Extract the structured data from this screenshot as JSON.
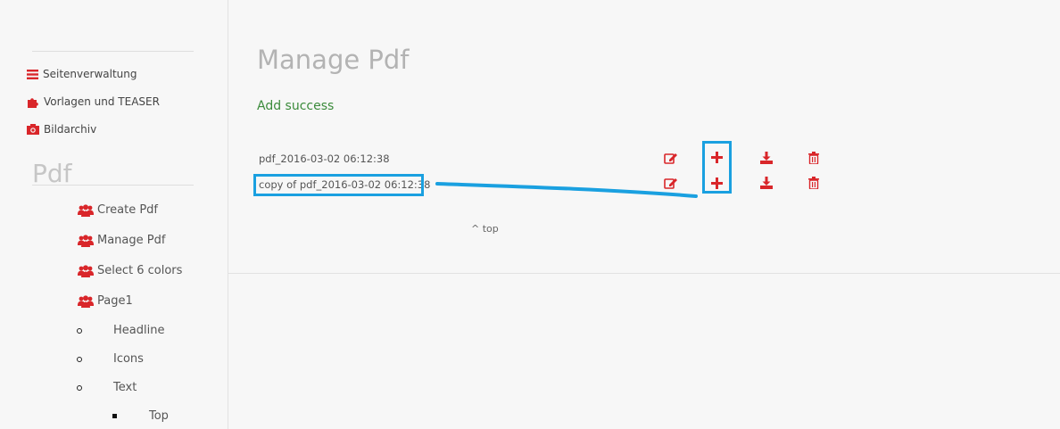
{
  "sidebar": {
    "nav": [
      {
        "label": "Seitenverwaltung",
        "icon": "bars-icon"
      },
      {
        "label": "Vorlagen und TEASER",
        "icon": "puzzle-icon"
      },
      {
        "label": "Bildarchiv",
        "icon": "camera-icon"
      }
    ],
    "section_title": "Pdf",
    "sub_items": [
      {
        "label": "Create Pdf",
        "icon": "users-icon"
      },
      {
        "label": "Manage Pdf",
        "icon": "users-icon"
      },
      {
        "label": "Select 6 colors",
        "icon": "users-icon"
      },
      {
        "label": "Page1",
        "icon": "users-icon"
      }
    ],
    "bullets": [
      "Headline",
      "Icons",
      "Text"
    ],
    "sub_bullets": [
      "Top"
    ]
  },
  "main": {
    "title": "Manage Pdf",
    "success_message": "Add success",
    "rows": [
      {
        "name": "pdf_2016-03-02 06:12:38"
      },
      {
        "name": "copy of pdf_2016-03-02 06:12:38"
      }
    ],
    "top_link": "^ top"
  },
  "colors": {
    "accent": "#d9262a",
    "success": "#3b8b3b",
    "highlight": "#1aa0e0"
  }
}
